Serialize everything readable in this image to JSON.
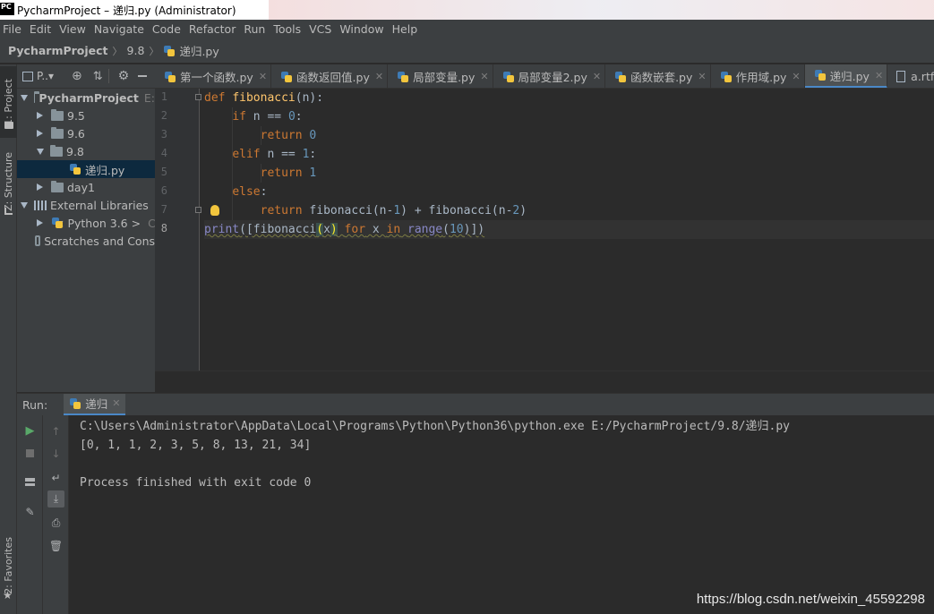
{
  "window": {
    "title": "PycharmProject – 递归.py (Administrator)",
    "logo_text": "PC"
  },
  "menubar": [
    "File",
    "Edit",
    "View",
    "Navigate",
    "Code",
    "Refactor",
    "Run",
    "Tools",
    "VCS",
    "Window",
    "Help"
  ],
  "breadcrumb": [
    "PycharmProject",
    "9.8",
    "递归.py"
  ],
  "left_strip": {
    "project_tab": "1: Project",
    "structure_tab": "Z: Structure",
    "favorites_tab": "2: Favorites"
  },
  "project_panel": {
    "header_label": "P..▾",
    "tree": [
      {
        "label": "PycharmProject",
        "suffix": "E:",
        "kind": "root",
        "expanded": true
      },
      {
        "label": "9.5",
        "kind": "folder",
        "expanded": false
      },
      {
        "label": "9.6",
        "kind": "folder",
        "expanded": false
      },
      {
        "label": "9.8",
        "kind": "folder",
        "expanded": true
      },
      {
        "label": "递归.py",
        "kind": "file",
        "selected": true
      },
      {
        "label": "day1",
        "kind": "folder",
        "expanded": false
      },
      {
        "label": "External Libraries",
        "kind": "libraries",
        "expanded": true
      },
      {
        "label": "< Python 3.6 >",
        "suffix": "C",
        "kind": "sdk",
        "expanded": false
      },
      {
        "label": "Scratches and Cons",
        "kind": "scratches"
      }
    ]
  },
  "tabs": [
    {
      "label": "第一个函数.py",
      "active": false
    },
    {
      "label": "函数返回值.py",
      "active": false
    },
    {
      "label": "局部变量.py",
      "active": false
    },
    {
      "label": "局部变量2.py",
      "active": false
    },
    {
      "label": "函数嵌套.py",
      "active": false
    },
    {
      "label": "作用域.py",
      "active": false
    },
    {
      "label": "递归.py",
      "active": true
    },
    {
      "label": "a.rtf",
      "active": false
    }
  ],
  "editor": {
    "line_numbers": [
      "1",
      "2",
      "3",
      "4",
      "5",
      "6",
      "7",
      "8"
    ],
    "current_line": 8
  },
  "run_panel": {
    "label": "Run:",
    "tab_label": "递归",
    "console": {
      "command": "C:\\Users\\Administrator\\AppData\\Local\\Programs\\Python\\Python36\\python.exe E:/PycharmProject/9.8/递归.py",
      "output": "[0, 1, 1, 2, 3, 5, 8, 13, 21, 34]",
      "blank": "",
      "exit": "Process finished with exit code 0"
    }
  },
  "watermark": "https://blog.csdn.net/weixin_45592298",
  "colors": {
    "background": "#2b2b2b",
    "panel": "#3c3f41",
    "keyword": "#cc7832",
    "function": "#ffc66d",
    "number": "#6897bb",
    "builtin": "#8888c6",
    "text": "#a9b7c6",
    "selection": "#0d293e",
    "accent": "#4a88c7"
  }
}
